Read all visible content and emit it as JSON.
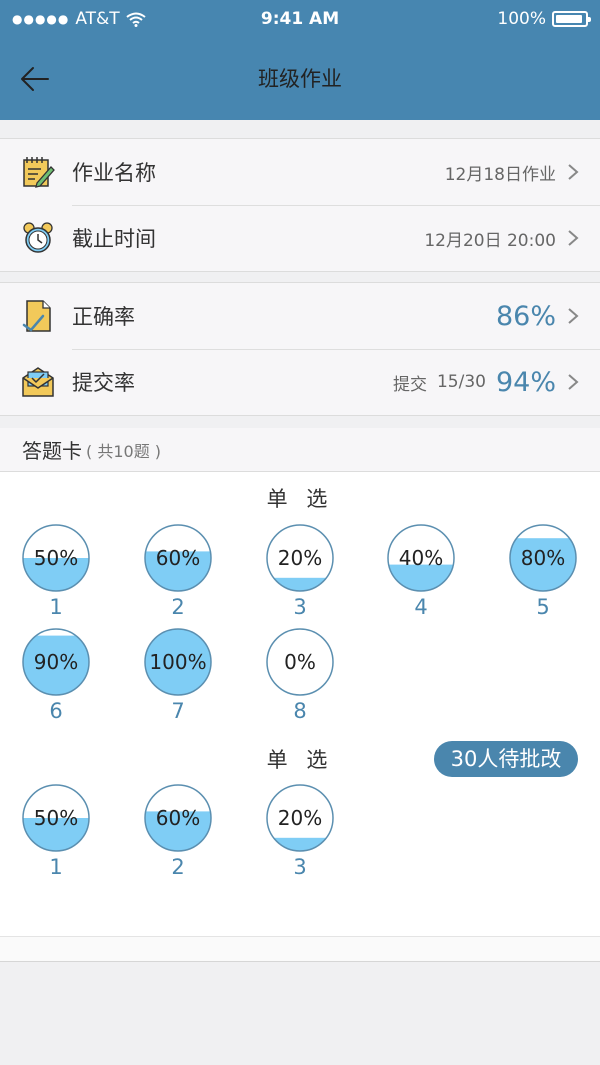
{
  "status_bar": {
    "carrier": "AT&T",
    "time": "9:41 AM",
    "battery": "100%"
  },
  "header": {
    "title": "班级作业"
  },
  "info_rows": [
    {
      "label": "作业名称",
      "value": "12月18日作业",
      "icon": "notepad-icon"
    },
    {
      "label": "截止时间",
      "value": "12月20日 20:00",
      "icon": "alarm-clock-icon"
    }
  ],
  "stat_rows": [
    {
      "label": "正确率",
      "value": "86%",
      "icon": "document-check-icon"
    },
    {
      "label": "提交率",
      "prefix": "提交",
      "count": "15/30",
      "value": "94%",
      "icon": "envelope-icon"
    }
  ],
  "answer_card": {
    "title": "答题卡",
    "count": "( 共10题 )"
  },
  "groups": [
    {
      "title": "单 选",
      "items": [
        {
          "num": "1",
          "pct": 50,
          "label": "50%"
        },
        {
          "num": "2",
          "pct": 60,
          "label": "60%"
        },
        {
          "num": "3",
          "pct": 20,
          "label": "20%"
        },
        {
          "num": "4",
          "pct": 40,
          "label": "40%"
        },
        {
          "num": "5",
          "pct": 80,
          "label": "80%"
        },
        {
          "num": "6",
          "pct": 90,
          "label": "90%"
        },
        {
          "num": "7",
          "pct": 100,
          "label": "100%"
        },
        {
          "num": "8",
          "pct": 0,
          "label": "0%"
        }
      ]
    },
    {
      "title": "单 选",
      "badge": "30人待批改",
      "items": [
        {
          "num": "1",
          "pct": 50,
          "label": "50%"
        },
        {
          "num": "2",
          "pct": 60,
          "label": "60%"
        },
        {
          "num": "3",
          "pct": 20,
          "label": "20%"
        }
      ]
    }
  ],
  "colors": {
    "header_bg": "#4786b0",
    "accent": "#4a86ad",
    "fill": "#7fcdf5",
    "circle_border": "#5b8fb0"
  }
}
